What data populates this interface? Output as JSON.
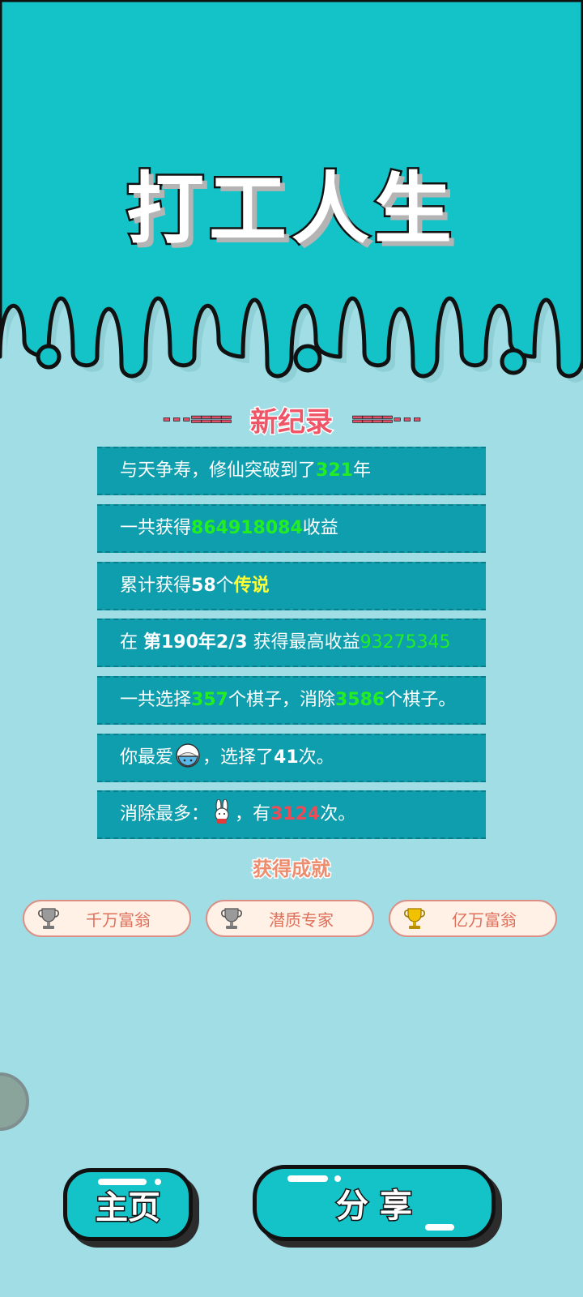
{
  "app": {
    "title": "打工人生"
  },
  "record": {
    "heading_left": "---====",
    "heading": "新纪录",
    "heading_right": "====---"
  },
  "stats": [
    {
      "before": "与天争寿，修仙突破到了",
      "value": "321",
      "after": "年"
    },
    {
      "before": "一共获得",
      "value": "864918084",
      "after": "收益"
    },
    {
      "before": "累计获得",
      "count": "58",
      "middle": "个",
      "tier": "传说"
    },
    {
      "before": "在 ",
      "period": "第190年2/3",
      "middle": " 获得最高收益",
      "value": "93275345"
    },
    {
      "before": "一共选择",
      "chosen": "357",
      "middle": "个棋子，消除",
      "cleared": "3586",
      "after": "个棋子。"
    },
    {
      "before": "你最爱",
      "icon": "rice-bowl-icon",
      "middle": "，选择了",
      "count": "41",
      "after": "次。"
    },
    {
      "before": "消除最多：",
      "icon": "rabbit-icon",
      "middle": "，有",
      "count": "3124",
      "after": "次。"
    }
  ],
  "achievements": {
    "title": "获得成就",
    "items": [
      {
        "label": "千万富翁",
        "icon": "trophy-silver-icon",
        "color": "#8a8a8a"
      },
      {
        "label": "潜质专家",
        "icon": "trophy-silver-icon",
        "color": "#8a8a8a"
      },
      {
        "label": "亿万富翁",
        "icon": "trophy-gold-icon",
        "color": "#e6b400"
      }
    ]
  },
  "buttons": {
    "home_label": "主页",
    "share_label": "分 享"
  },
  "colors": {
    "header_bg": "#14c3c8",
    "body_bg": "#a0dde5",
    "row_bg": "#0e9eae",
    "accent_pink": "#ef5566",
    "highlight_green": "#22ee22",
    "highlight_yellow": "#ffff33",
    "highlight_red": "#ee4b57"
  }
}
